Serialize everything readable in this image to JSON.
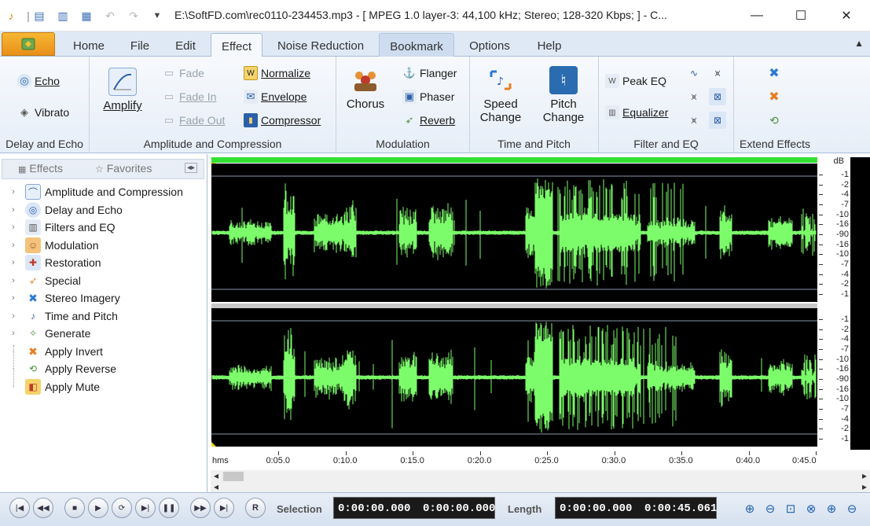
{
  "window": {
    "title": "E:\\SoftFD.com\\rec0110-234453.mp3 - [ MPEG 1.0 layer-3: 44,100 kHz; Stereo; 128-320 Kbps;  ] - C...",
    "minimize": "—",
    "maximize": "☐",
    "close": "✕"
  },
  "quick_access": [
    "app-icon",
    "new-icon",
    "open-icon",
    "save-icon",
    "undo-icon",
    "redo-icon",
    "customize-icon"
  ],
  "tabs": [
    {
      "label": "Home"
    },
    {
      "label": "File"
    },
    {
      "label": "Edit"
    },
    {
      "label": "Effect"
    },
    {
      "label": "Noise Reduction"
    },
    {
      "label": "Bookmark"
    },
    {
      "label": "Options"
    },
    {
      "label": "Help"
    }
  ],
  "ribbon": {
    "delay_echo": {
      "label": "Delay and Echo",
      "echo": "Echo",
      "vibrato": "Vibrato"
    },
    "amplitude": {
      "label": "Amplitude and Compression",
      "amplify": "Amplify",
      "fade": "Fade",
      "fade_in": "Fade In",
      "fade_out": "Fade Out",
      "normalize": "Normalize",
      "envelope": "Envelope",
      "compressor": "Compressor"
    },
    "modulation": {
      "label": "Modulation",
      "chorus": "Chorus",
      "flanger": "Flanger",
      "phaser": "Phaser",
      "reverb": "Reverb"
    },
    "time_pitch": {
      "label": "Time and Pitch",
      "speed_1": "Speed",
      "speed_2": "Change",
      "pitch_1": "Pitch",
      "pitch_2": "Change"
    },
    "filter_eq": {
      "label": "Filter and EQ",
      "peak_eq": "Peak EQ",
      "equalizer": "Equalizer"
    },
    "extend": {
      "label": "Extend Effects"
    }
  },
  "left_panel": {
    "tab_effects": "Effects",
    "tab_favorites": "Favorites",
    "tree": [
      {
        "label": "Amplitude and Compression",
        "icon": "amplitude-icon",
        "expandable": true
      },
      {
        "label": "Delay and Echo",
        "icon": "echo-icon",
        "expandable": true
      },
      {
        "label": "Filters and EQ",
        "icon": "filter-icon",
        "expandable": true
      },
      {
        "label": "Modulation",
        "icon": "modulation-icon",
        "expandable": true
      },
      {
        "label": "Restoration",
        "icon": "restoration-icon",
        "expandable": true
      },
      {
        "label": "Special",
        "icon": "special-icon",
        "expandable": true
      },
      {
        "label": "Stereo Imagery",
        "icon": "stereo-icon",
        "expandable": true
      },
      {
        "label": "Time and Pitch",
        "icon": "time-pitch-icon",
        "expandable": true
      },
      {
        "label": "Generate",
        "icon": "generate-icon",
        "expandable": true
      },
      {
        "label": "Apply Invert",
        "icon": "invert-icon",
        "expandable": false
      },
      {
        "label": "Apply Reverse",
        "icon": "reverse-icon",
        "expandable": false
      },
      {
        "label": "Apply Mute",
        "icon": "mute-icon",
        "expandable": false
      }
    ]
  },
  "waveform": {
    "db_unit": "dB",
    "db_ticks_channel": [
      "-1",
      "-2",
      "-4",
      "-7",
      "-10",
      "-16",
      "-90",
      "-16",
      "-10",
      "-7",
      "-4",
      "-2",
      "-1"
    ],
    "timeline_unit": "hms",
    "timeline_labels": [
      "0:05.0",
      "0:10.0",
      "0:15.0",
      "0:20.0",
      "0:25.0",
      "0:30.0",
      "0:35.0",
      "0:40.0",
      "0:45.0"
    ],
    "wave_color": "#7cfc6a",
    "background_color": "#000000",
    "duration_seconds": 45.061
  },
  "transport": {
    "record_label": "R",
    "selection_label": "Selection",
    "selection_start": "0:00:00.000",
    "selection_end": "0:00:00.000",
    "length_label": "Length",
    "length_start": "0:00:00.000",
    "length_end": "0:00:45.061"
  },
  "watermark": "SoftFD.com"
}
